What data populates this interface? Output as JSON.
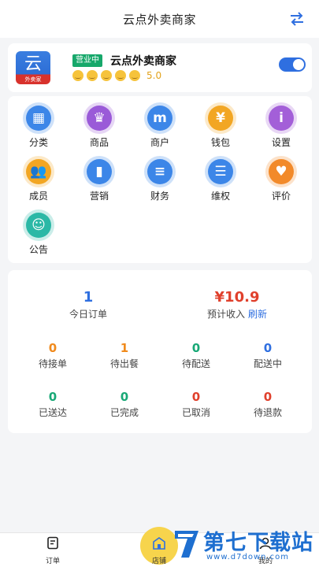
{
  "header": {
    "title": "云点外卖商家",
    "swap_icon": "swap-arrows-icon"
  },
  "store": {
    "logo_text": "云",
    "logo_subtext": "外卖家",
    "status": "营业中",
    "name": "云点外卖商家",
    "rating": "5.0",
    "rating_faces": 5,
    "open": true
  },
  "menu": [
    {
      "label": "分类",
      "icon": "category-icon",
      "color": "#3d86e8",
      "glyph": "▦"
    },
    {
      "label": "商品",
      "icon": "crown-icon",
      "color": "#9a5ad8",
      "glyph": "♛"
    },
    {
      "label": "商户",
      "icon": "shop-icon",
      "color": "#3d86e8",
      "glyph": "m"
    },
    {
      "label": "钱包",
      "icon": "wallet-icon",
      "color": "#f2a623",
      "glyph": "¥"
    },
    {
      "label": "设置",
      "icon": "settings-icon",
      "color": "#a35fd8",
      "glyph": "i"
    },
    {
      "label": "成员",
      "icon": "members-icon",
      "color": "#f2a623",
      "glyph": "👥"
    },
    {
      "label": "营销",
      "icon": "marketing-icon",
      "color": "#3d86e8",
      "glyph": "▮"
    },
    {
      "label": "财务",
      "icon": "finance-icon",
      "color": "#3d86e8",
      "glyph": "≡"
    },
    {
      "label": "维权",
      "icon": "rights-icon",
      "color": "#3d86e8",
      "glyph": "☰"
    },
    {
      "label": "评价",
      "icon": "review-heart-icon",
      "color": "#f28a2a",
      "glyph": "♥"
    },
    {
      "label": "公告",
      "icon": "announcement-icon",
      "color": "#2bb9a6",
      "glyph": "☺"
    }
  ],
  "stats": {
    "today_orders": {
      "value": "1",
      "label": "今日订单",
      "color": "#2f6fe0"
    },
    "expected_income": {
      "value": "¥10.9",
      "label": "预计收入",
      "refresh_label": "刷新",
      "color": "#e0402c"
    },
    "items": [
      {
        "value": "0",
        "label": "待接单",
        "color": "#f08a1c"
      },
      {
        "value": "1",
        "label": "待出餐",
        "color": "#f08a1c"
      },
      {
        "value": "0",
        "label": "待配送",
        "color": "#18a876"
      },
      {
        "value": "0",
        "label": "配送中",
        "color": "#2f6fe0"
      },
      {
        "value": "0",
        "label": "已送达",
        "color": "#18a876"
      },
      {
        "value": "0",
        "label": "已完成",
        "color": "#18a876"
      },
      {
        "value": "0",
        "label": "已取消",
        "color": "#e0402c"
      },
      {
        "value": "0",
        "label": "待退款",
        "color": "#e0402c"
      }
    ]
  },
  "tabbar": {
    "tabs": [
      {
        "label": "订单",
        "icon": "order-receipt-icon"
      },
      {
        "label": "店铺",
        "icon": "store-icon"
      },
      {
        "label": "我的",
        "icon": "profile-icon"
      }
    ]
  },
  "watermark": {
    "title": "第七下载站",
    "url": "www.d7down.com"
  }
}
